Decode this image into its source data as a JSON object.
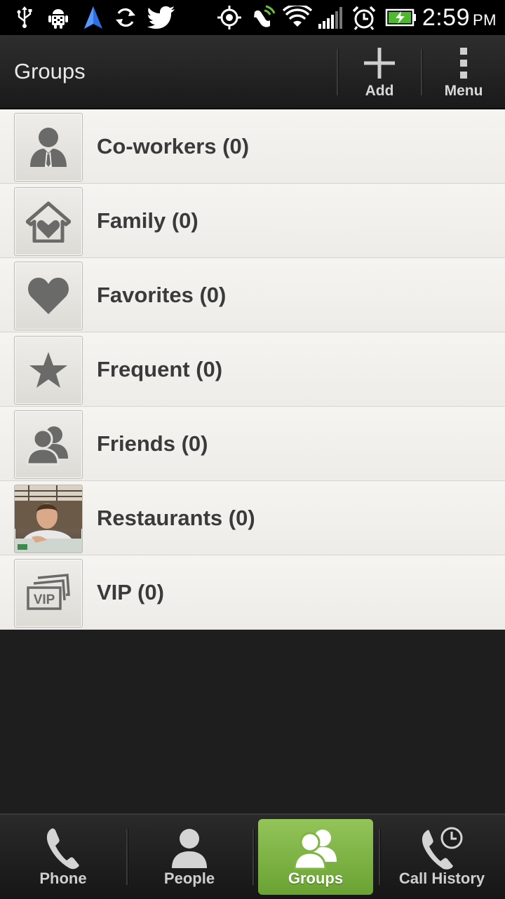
{
  "status_bar": {
    "time": "2:59",
    "ampm": "PM",
    "icons": [
      "usb-icon",
      "android-debug-icon",
      "navigation-icon",
      "sync-icon",
      "twitter-icon",
      "gps-icon",
      "nfc-icon",
      "wifi-icon",
      "signal-icon",
      "alarm-icon",
      "battery-charging-icon"
    ]
  },
  "action_bar": {
    "title": "Groups",
    "add_label": "Add",
    "menu_label": "Menu"
  },
  "groups": [
    {
      "name": "Co-workers (0)",
      "icon": "coworker-icon"
    },
    {
      "name": "Family (0)",
      "icon": "house-heart-icon"
    },
    {
      "name": "Favorites (0)",
      "icon": "heart-icon"
    },
    {
      "name": "Frequent (0)",
      "icon": "star-icon"
    },
    {
      "name": "Friends (0)",
      "icon": "friends-icon"
    },
    {
      "name": "Restaurants (0)",
      "icon": "group-photo"
    },
    {
      "name": "VIP (0)",
      "icon": "vip-ticket-icon"
    }
  ],
  "tabs": [
    {
      "label": "Phone",
      "icon": "phone-icon"
    },
    {
      "label": "People",
      "icon": "person-icon"
    },
    {
      "label": "Groups",
      "icon": "groups-icon",
      "active": true
    },
    {
      "label": "Call History",
      "icon": "call-history-icon"
    }
  ],
  "colors": {
    "accent": "#7fb545",
    "list_bg": "#f1f0ec",
    "text": "#3a3a3a"
  }
}
